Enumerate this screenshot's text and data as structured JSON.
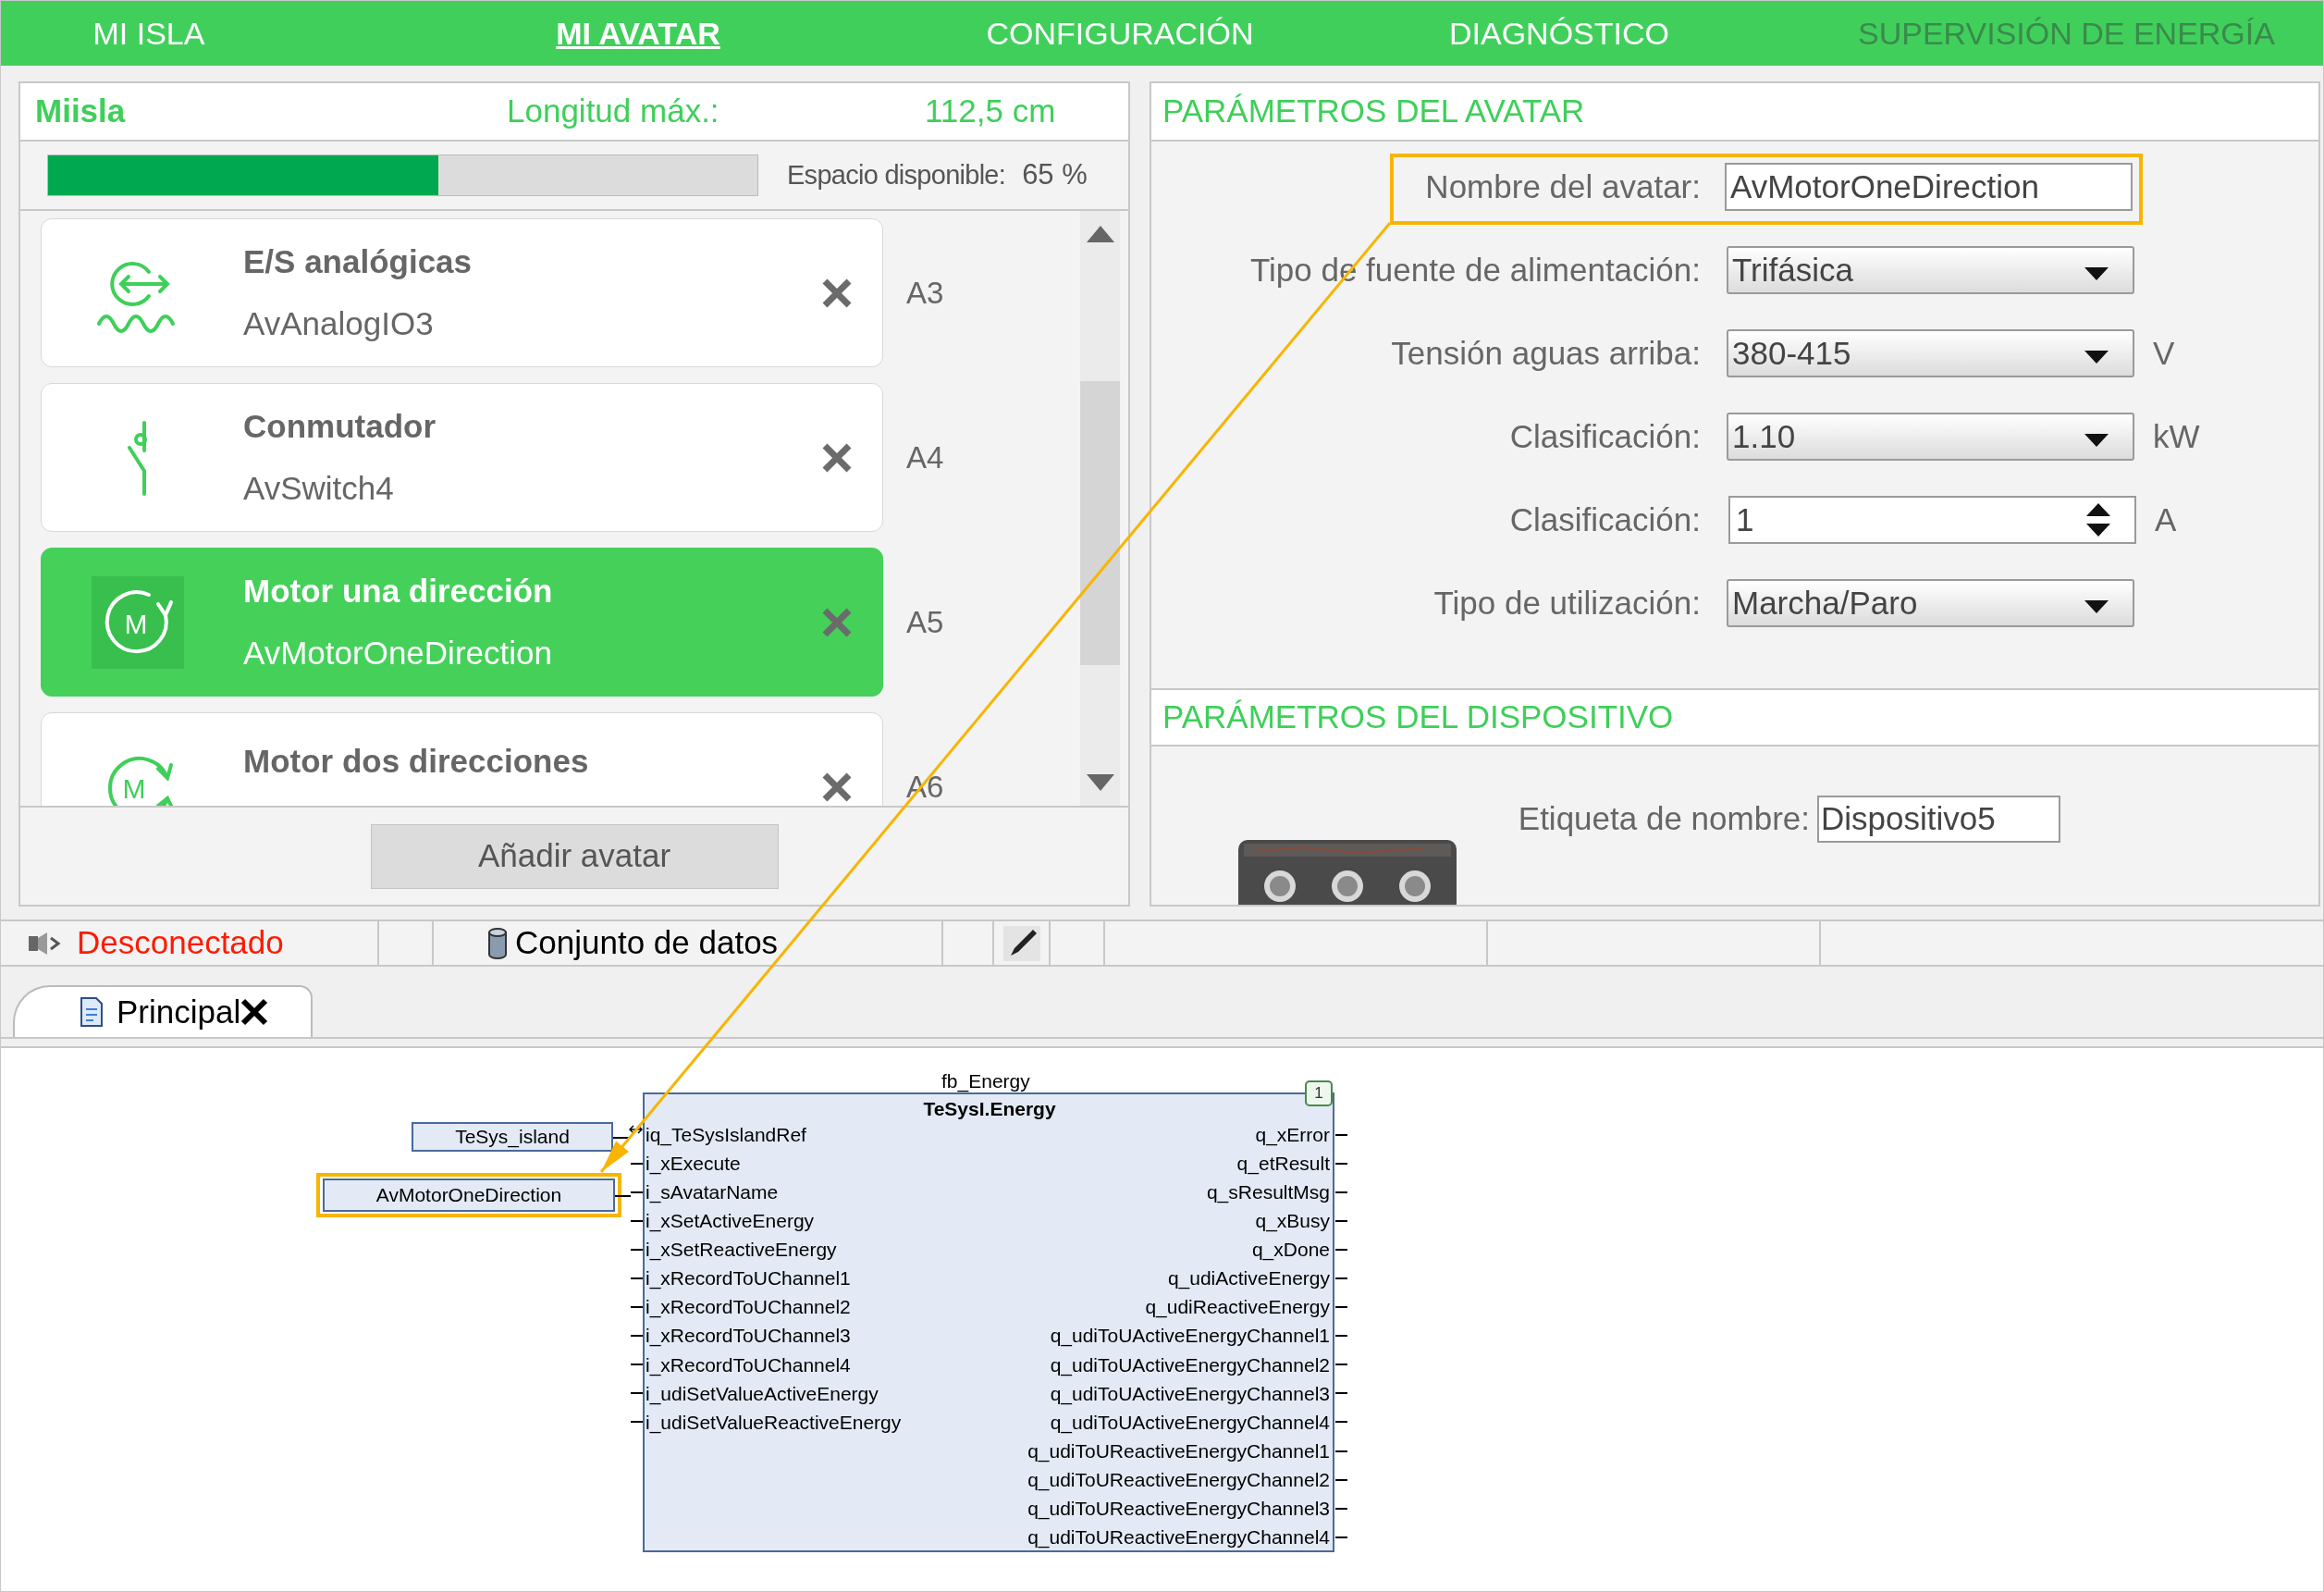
{
  "nav": [
    {
      "label": "MI ISLA",
      "selected": false,
      "disabled": false
    },
    {
      "label": "MI AVATAR",
      "selected": true,
      "disabled": false
    },
    {
      "label": "CONFIGURACIÓN",
      "selected": false,
      "disabled": false
    },
    {
      "label": "DIAGNÓSTICO",
      "selected": false,
      "disabled": false
    },
    {
      "label": "SUPERVISIÓN DE ENERGÍA",
      "selected": false,
      "disabled": true
    }
  ],
  "island": {
    "name": "Miisla",
    "max_length_label": "Longitud máx.:",
    "max_length": "112,5 cm",
    "space_label": "Espacio disponible:",
    "space_value": "65 %",
    "level": 0.55
  },
  "avatars": [
    {
      "kind": "analog",
      "title": "E/S analógicas",
      "name": "AvAnalogIO3",
      "slot": "A3",
      "selected": false
    },
    {
      "kind": "switch",
      "title": "Conmutador",
      "name": "AvSwitch4",
      "slot": "A4",
      "selected": false
    },
    {
      "kind": "motor_one",
      "icon_label": "M",
      "title": "Motor una dirección",
      "name": "AvMotorOneDirection",
      "slot": "A5",
      "selected": true
    },
    {
      "kind": "motor_two",
      "icon_label": "M",
      "title": "Motor dos direcciones",
      "slot": "A6",
      "selected": false
    }
  ],
  "add_button": "Añadir avatar",
  "avatar_parameters": {
    "title": "PARÁMETROS DEL AVATAR",
    "fields": [
      {
        "kind": "text",
        "label": "Nombre del avatar:",
        "value": "AvMotorOneDirection",
        "highlighted": true
      },
      {
        "kind": "dropdown",
        "label": "Tipo de fuente de alimentación:",
        "value": "Trifásica",
        "highlighted": false
      },
      {
        "kind": "dropdown",
        "label": "Tensión aguas arriba:",
        "value": "380-415",
        "unit": "V",
        "highlighted": false
      },
      {
        "kind": "dropdown",
        "label": "Clasificación:",
        "value": "1.10",
        "unit": "kW",
        "highlighted": false
      },
      {
        "kind": "spinner",
        "label": "Clasificación:",
        "value": "1",
        "unit": "A",
        "highlighted": false
      },
      {
        "kind": "dropdown",
        "label": "Tipo de utilización:",
        "value": "Marcha/Paro",
        "highlighted": false
      }
    ]
  },
  "device_parameters": {
    "title": "PARÁMETROS DEL DISPOSITIVO",
    "label": "Etiqueta de nombre:",
    "value": "Dispositivo5"
  },
  "status_bar": {
    "connection": "Desconectado",
    "dataset": "Conjunto de datos"
  },
  "editor_tabs": [
    {
      "label": "Principal",
      "selected": true
    }
  ],
  "diagram": {
    "instance": "fb_Energy",
    "type": "TeSysI.Energy",
    "badge": "1",
    "variables": [
      {
        "value": "TeSys_island",
        "highlighted": false
      },
      {
        "value": "AvMotorOneDirection",
        "highlighted": true
      }
    ],
    "inputs": [
      {
        "name": "iq_TeSysIslandRef",
        "kind": "inout"
      },
      {
        "name": "i_xExecute",
        "kind": "input"
      },
      {
        "name": "i_sAvatarName",
        "kind": "input"
      },
      {
        "name": "i_xSetActiveEnergy",
        "kind": "input"
      },
      {
        "name": "i_xSetReactiveEnergy",
        "kind": "input"
      },
      {
        "name": "i_xRecordToUChannel1",
        "kind": "input"
      },
      {
        "name": "i_xRecordToUChannel2",
        "kind": "input"
      },
      {
        "name": "i_xRecordToUChannel3",
        "kind": "input"
      },
      {
        "name": "i_xRecordToUChannel4",
        "kind": "input"
      },
      {
        "name": "i_udiSetValueActiveEnergy",
        "kind": "input"
      },
      {
        "name": "i_udiSetValueReactiveEnergy",
        "kind": "input"
      }
    ],
    "outputs": [
      "q_xError",
      "q_etResult",
      "q_sResultMsg",
      "q_xBusy",
      "q_xDone",
      "q_udiActiveEnergy",
      "q_udiReactiveEnergy",
      "q_udiToUActiveEnergyChannel1",
      "q_udiToUActiveEnergyChannel2",
      "q_udiToUActiveEnergyChannel3",
      "q_udiToUActiveEnergyChannel4",
      "q_udiToUReactiveEnergyChannel1",
      "q_udiToUReactiveEnergyChannel2",
      "q_udiToUReactiveEnergyChannel3",
      "q_udiToUReactiveEnergyChannel4"
    ]
  }
}
